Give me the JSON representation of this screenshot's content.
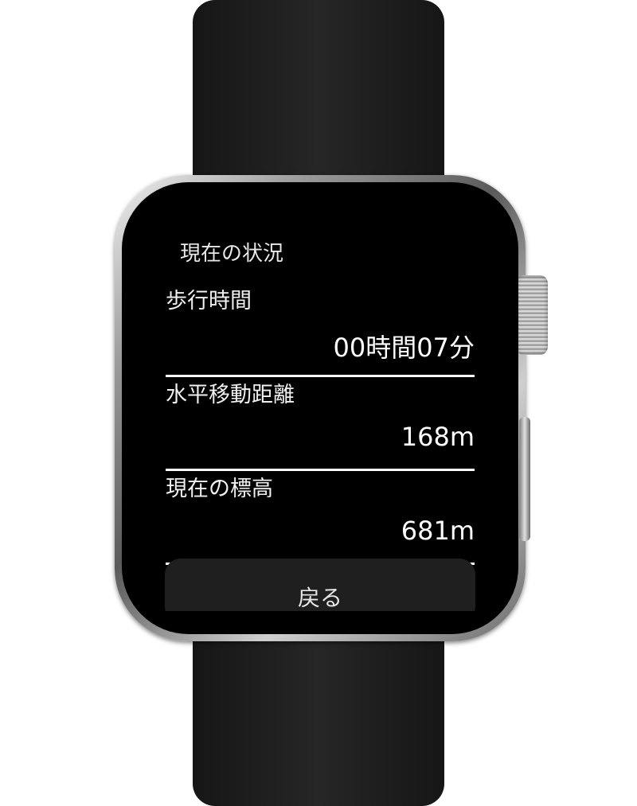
{
  "screen": {
    "title": "現在の状況",
    "metrics": [
      {
        "label": "歩行時間",
        "value": "00時間07分"
      },
      {
        "label": "水平移動距離",
        "value": "168m"
      },
      {
        "label": "現在の標高",
        "value": "681m"
      }
    ],
    "back_label": "戻る"
  }
}
